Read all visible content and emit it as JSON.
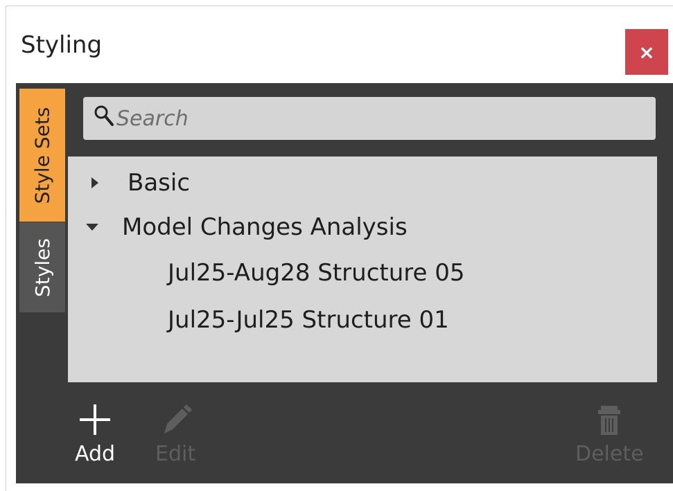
{
  "window": {
    "title": "Styling",
    "close_label": "×"
  },
  "tabs": [
    {
      "label": "Style Sets",
      "active": true
    },
    {
      "label": "Styles",
      "active": false
    }
  ],
  "search": {
    "placeholder": "Search",
    "value": ""
  },
  "tree": {
    "items": [
      {
        "label": "Basic",
        "expanded": false,
        "level": 0
      },
      {
        "label": "Model Changes Analysis",
        "expanded": true,
        "level": 0
      },
      {
        "label": "Jul25-Aug28 Structure 05",
        "level": 1
      },
      {
        "label": "Jul25-Jul25 Structure 01",
        "level": 1
      }
    ]
  },
  "toolbar": {
    "add_label": "Add",
    "edit_label": "Edit",
    "delete_label": "Delete"
  },
  "colors": {
    "accent": "#f4a340",
    "close": "#cf454e",
    "panel_dark": "#3b3b3b",
    "list_bg": "#d7d7d7"
  },
  "icons": [
    "search-icon",
    "close-icon",
    "add-icon",
    "edit-icon",
    "delete-icon",
    "caret-right-icon",
    "caret-down-icon"
  ]
}
